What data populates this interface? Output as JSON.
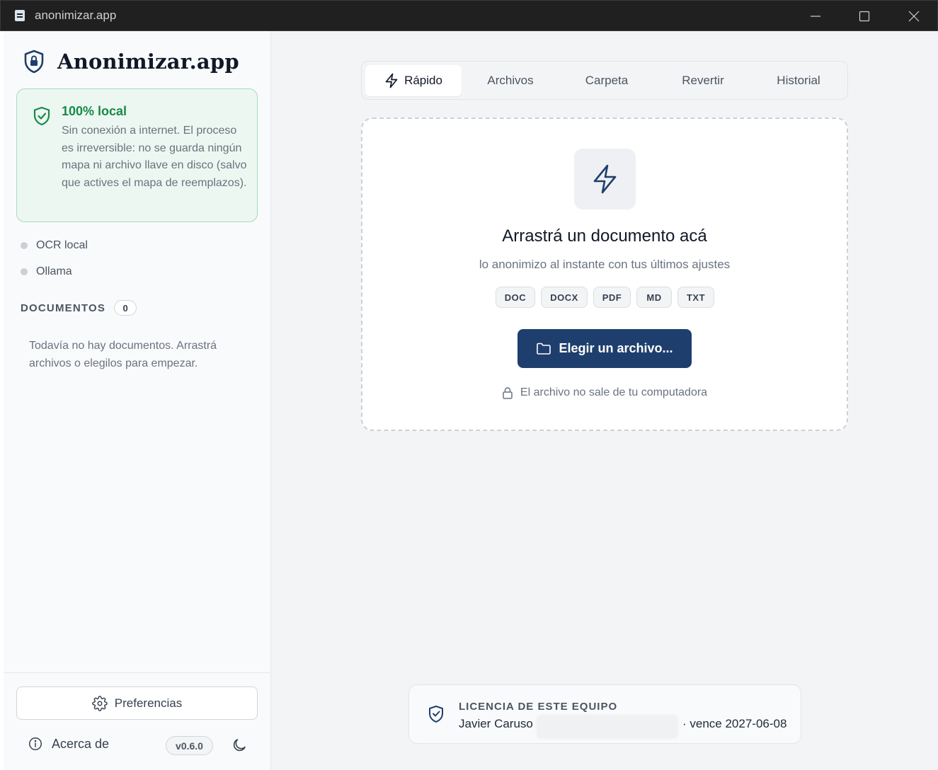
{
  "window": {
    "title": "anonimizar.app"
  },
  "sidebar": {
    "brand": "Anonimizar.app",
    "local_card": {
      "title": "100% local",
      "text": "Sin conexión a internet. El proceso es irreversible: no se guarda ningún mapa ni archivo llave en disco (salvo que actives el mapa de reemplazos)."
    },
    "status": [
      {
        "label": "OCR local"
      },
      {
        "label": "Ollama"
      }
    ],
    "documents": {
      "label": "DOCUMENTOS",
      "count": "0",
      "empty_text": "Todavía no hay documentos. Arrastrá archivos o elegilos para empezar."
    },
    "preferences_label": "Preferencias",
    "about_label": "Acerca de",
    "version": "v0.6.0"
  },
  "tabs": [
    {
      "label": "Rápido",
      "active": true
    },
    {
      "label": "Archivos",
      "active": false
    },
    {
      "label": "Carpeta",
      "active": false
    },
    {
      "label": "Revertir",
      "active": false
    },
    {
      "label": "Historial",
      "active": false
    }
  ],
  "dropzone": {
    "title": "Arrastrá un documento acá",
    "subtitle": "lo anonimizo al instante con tus últimos ajustes",
    "formats": [
      "DOC",
      "DOCX",
      "PDF",
      "MD",
      "TXT"
    ],
    "button_label": "Elegir un archivo...",
    "note": "El archivo no sale de tu computadora"
  },
  "license": {
    "title": "LICENCIA DE ESTE EQUIPO",
    "holder": "Javier Caruso",
    "expiry": "· vence 2027-06-08"
  },
  "colors": {
    "accent": "#1e3f6e",
    "success": "#178a49",
    "success_bg": "#ecf7f1"
  }
}
